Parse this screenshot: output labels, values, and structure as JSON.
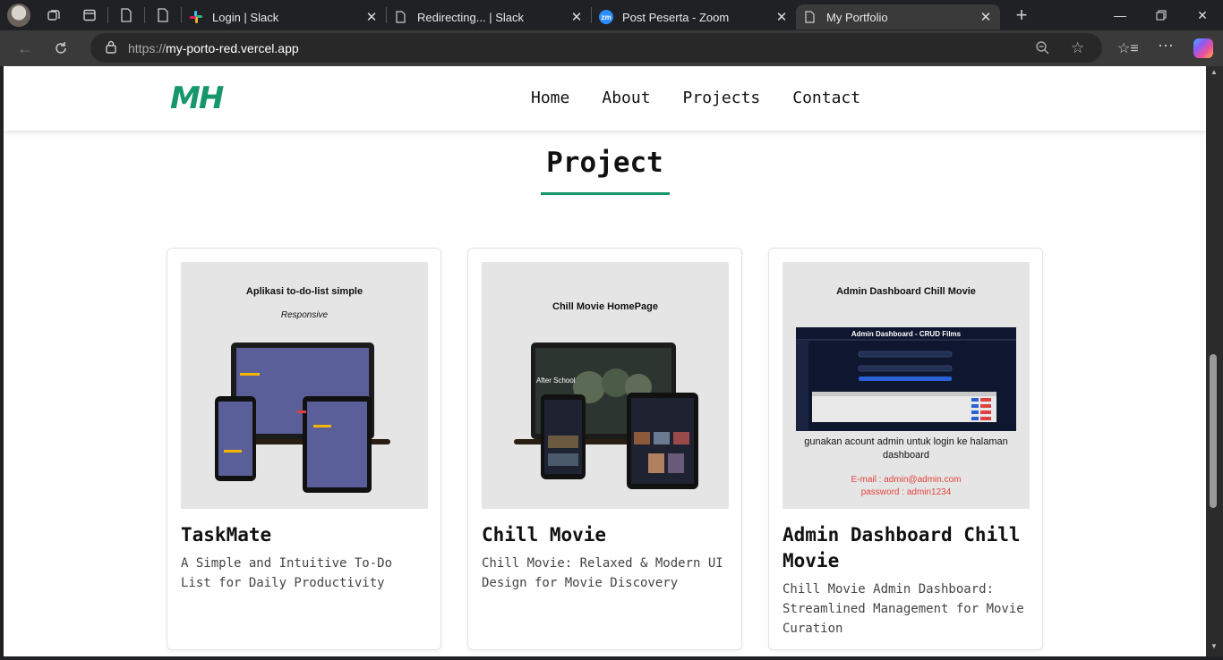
{
  "tabs": [
    {
      "title": "Login | Slack",
      "icon": "slack-icon"
    },
    {
      "title": "Redirecting... | Slack",
      "icon": "page-icon"
    },
    {
      "title": "Post Peserta - Zoom",
      "icon": "zoom-icon",
      "icon_text": "zm"
    },
    {
      "title": "My Portfolio",
      "icon": "page-icon",
      "active": true
    }
  ],
  "address": {
    "prefix": "https://",
    "host": "my-porto-red.vercel.app"
  },
  "site": {
    "logo": "MH",
    "nav": [
      "Home",
      "About",
      "Projects",
      "Contact"
    ],
    "section_title": "Project",
    "accent": "#15966b"
  },
  "projects": [
    {
      "title": "TaskMate",
      "description": "A Simple and Intuitive To-Do List for Daily Productivity",
      "thumb": {
        "heading": "Aplikasi to-do-list simple",
        "subheading": "Responsive"
      }
    },
    {
      "title": "Chill Movie",
      "description": "Chill Movie: Relaxed & Modern UI Design for Movie Discovery",
      "thumb": {
        "heading": "Chill Movie HomePage",
        "hero_text": "After School"
      }
    },
    {
      "title": "Admin Dashboard Chill Movie",
      "description": "Chill Movie Admin Dashboard: Streamlined Management for Movie Curation",
      "thumb": {
        "heading": "Admin Dashboard Chill Movie",
        "screen_title": "Admin Dashboard - CRUD Films",
        "note": "gunakan acount admin untuk login ke halaman dashboard",
        "email": "E-mail : admin@admin.com",
        "password": "password : admin1234"
      }
    }
  ]
}
